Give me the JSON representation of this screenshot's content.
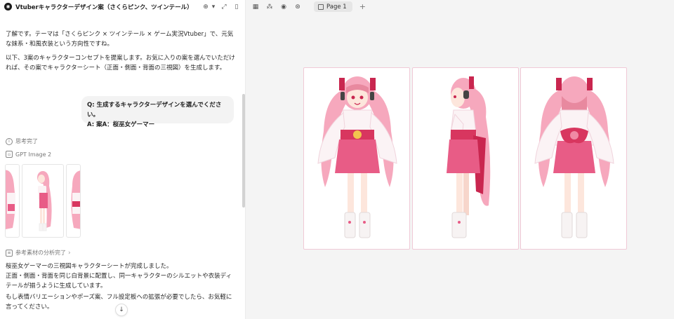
{
  "window": {
    "title": "Vtuberキャラクターデザイン案（さくらピンク、ツインテール）"
  },
  "chat": {
    "assistant_intro_1": "了解です。テーマは「さくらピンク × ツインテール × ゲーム実況Vtuber」で、元気な妹系・和風衣装という方向性ですね。",
    "assistant_intro_2": "以下、3案のキャラクターコンセプトを提案します。お気に入りの案を選んでいただければ、その案でキャラクターシート（正面・側面・背面の三視図）を生成します。",
    "user_line_1": "Q: 生成するキャラクターデザインを選んでください。",
    "user_line_2": "A: 案A：桜巫女ゲーマー",
    "status_thinking": "思考完了",
    "status_model": "GPT Image 2",
    "status_analysis": "参考素材の分析完了",
    "result_1": "桜巫女ゲーマーの三視図キャラクターシートが完成しました。",
    "result_2": "正面・側面・背面を同じ白背景に配置し、同一キャラクターのシルエットや衣装ディテールが揃うように生成しています。",
    "result_3": "もし表情バリエーションやポーズ案、フル設定板への拡張が必要でしたら、お気軽に言ってください。"
  },
  "canvas": {
    "page_tab": "Page 1",
    "views": [
      "front",
      "side",
      "back"
    ]
  },
  "colors": {
    "hair": "#f6a8bd",
    "hair_dark": "#e8899f",
    "robe": "#fbf3f5",
    "skirt": "#e85c86",
    "obi": "#d8365f",
    "ribbon": "#c9264f",
    "skin": "#fde6dc",
    "boot": "#f7f3f3"
  },
  "icons": {
    "app": "chatgpt-logo-icon",
    "add": "add-circle-icon",
    "expand": "expand-icon",
    "sidebar": "sidebar-toggle-icon"
  }
}
